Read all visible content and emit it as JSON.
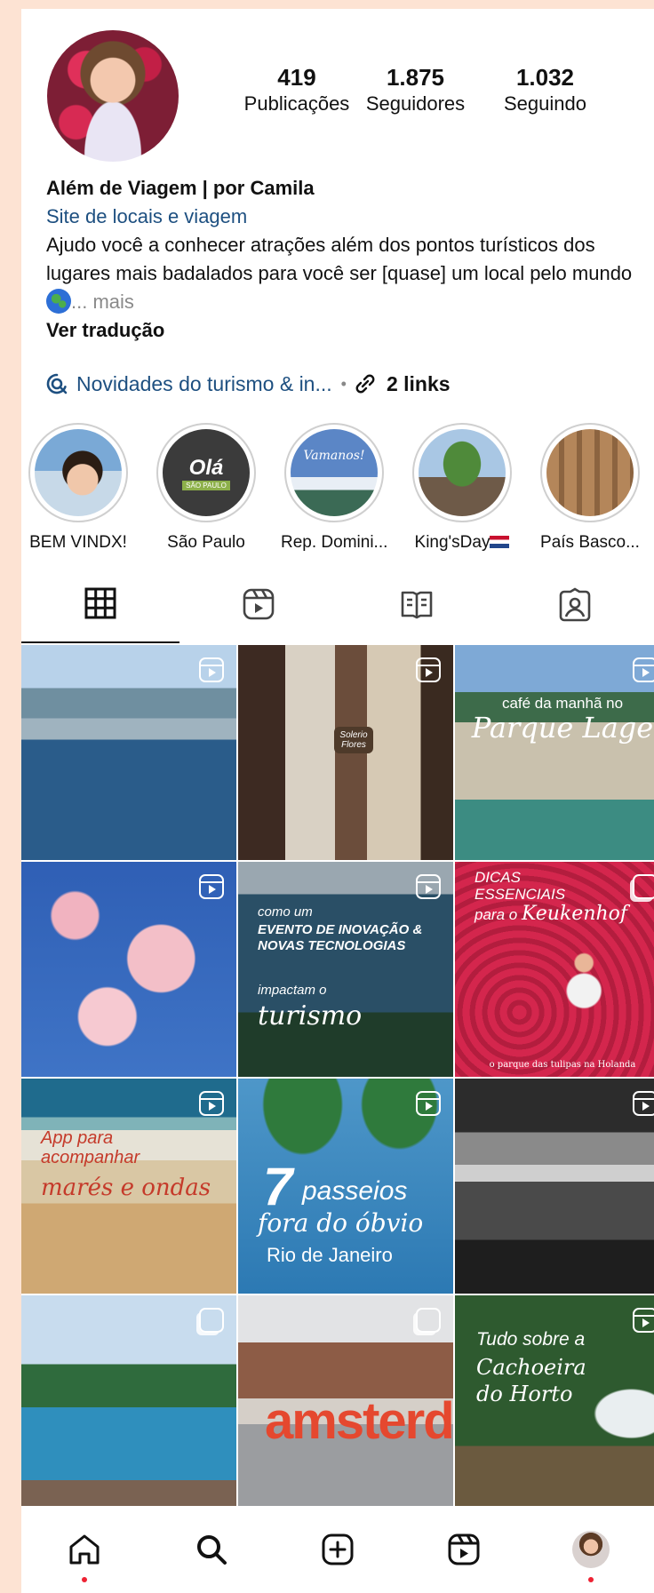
{
  "profile": {
    "stats": [
      {
        "value": "419",
        "label": "Publicações"
      },
      {
        "value": "1.875",
        "label": "Seguidores"
      },
      {
        "value": "1.032",
        "label": "Seguindo"
      }
    ],
    "name": "Além de Viagem | por Camila",
    "category": "Site de locais e viagem",
    "bio": "Ajudo você a conhecer atrações além dos pontos turísticos dos lugares mais badalados para você ser [quase] um local pelo mundo",
    "bio_emoji": "globe-icon",
    "more_label": "... mais",
    "translate_label": "Ver tradução",
    "thread_label": "Novidades do turismo & in...",
    "links_label": "2 links"
  },
  "highlights": [
    {
      "label": "BEM VINDX!"
    },
    {
      "label": "São Paulo",
      "cover_text": "Olá",
      "cover_sub": "SÃO PAULO"
    },
    {
      "label": "Rep. Domini...",
      "cover_text": "Vamanos!"
    },
    {
      "label": "King'sDay"
    },
    {
      "label": "País Basco..."
    }
  ],
  "tabs": [
    "grid-icon",
    "reels-icon",
    "guides-icon",
    "tagged-icon"
  ],
  "posts": [
    {
      "badge": "reel"
    },
    {
      "badge": "reel",
      "overlay": "Solerio Flores"
    },
    {
      "badge": "reel",
      "line1": "café da manhã no",
      "line2": "Parque Lage"
    },
    {
      "badge": "reel"
    },
    {
      "badge": "reel",
      "line1": "como um",
      "line2": "EVENTO DE INOVAÇÃO & NOVAS TECNOLOGIAS",
      "line3": "impactam o",
      "line4": "turismo"
    },
    {
      "badge": "multi",
      "line1": "DICAS ESSENCIAIS",
      "line2": "para o",
      "line3": "Keukenhof",
      "caption": "o parque das tulipas na Holanda"
    },
    {
      "badge": "reel",
      "line1": "App para acompanhar",
      "line2": "marés e ondas"
    },
    {
      "badge": "reel",
      "line1": "7",
      "line2": "passeios",
      "line3": "fora do óbvio",
      "line4": "Rio de Janeiro"
    },
    {
      "badge": "reel"
    },
    {
      "badge": "multi"
    },
    {
      "badge": "multi",
      "sign": "amsterd"
    },
    {
      "badge": "reel",
      "line1": "Tudo sobre a",
      "line2": "Cachoeira do Horto"
    }
  ],
  "nav": [
    "home-icon",
    "search-icon",
    "create-icon",
    "reels-icon",
    "profile-avatar"
  ],
  "colors": {
    "background": "#fde3d3",
    "link": "#1d4f80",
    "notification": "#e22233"
  }
}
